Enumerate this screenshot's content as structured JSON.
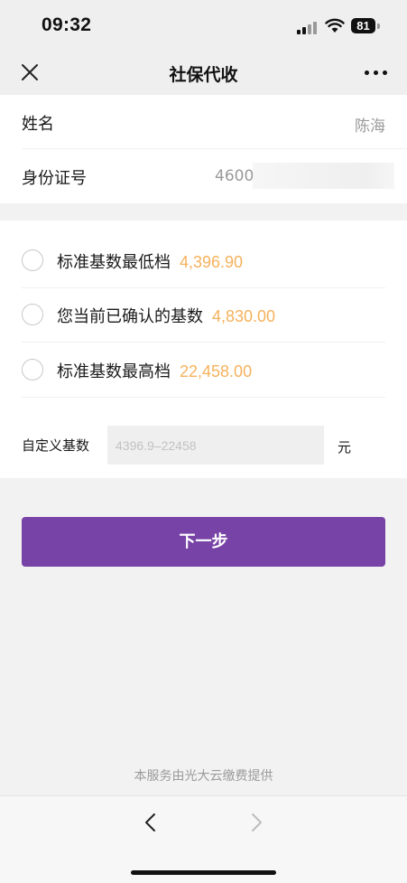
{
  "status_bar": {
    "time": "09:32",
    "battery": "81",
    "icons": [
      "signal-icon",
      "wifi-icon",
      "battery-icon"
    ]
  },
  "nav": {
    "title": "社保代收",
    "close_icon": "close-icon",
    "more_icon": "more-icon"
  },
  "info": {
    "name_label": "姓名",
    "name_value": "陈海",
    "id_label": "身份证号",
    "id_value_visible": "4600"
  },
  "base_options": [
    {
      "label": "标准基数最低档",
      "amount": "4,396.90"
    },
    {
      "label": "您当前已确认的基数",
      "amount": "4,830.00"
    },
    {
      "label": "标准基数最高档",
      "amount": "22,458.00"
    }
  ],
  "custom_base": {
    "label": "自定义基数",
    "placeholder": "4396.9–22458",
    "unit": "元"
  },
  "next_button": {
    "label": "下一步"
  },
  "footer": {
    "provider_note": "本服务由光大云缴费提供"
  },
  "toolbar": {
    "back_icon": "chevron-left-icon",
    "forward_icon": "chevron-right-icon"
  },
  "colors": {
    "accent": "#7743a6",
    "amount": "#f6b15c",
    "background": "#f2f2f2"
  }
}
